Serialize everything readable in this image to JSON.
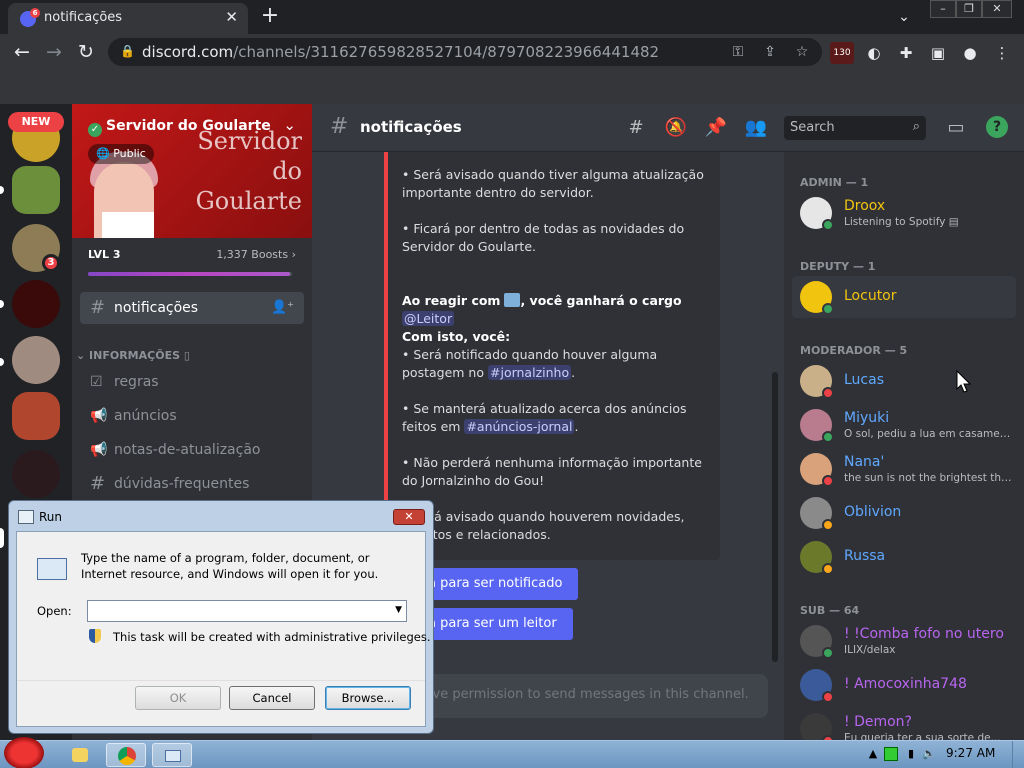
{
  "browser": {
    "tab_title": "notificações",
    "tab_badge": "6",
    "url_domain": "discord.com",
    "url_path": "/channels/311627659828527104/879708223966441482",
    "ext_badge": "130"
  },
  "guilds": {
    "new_badge": "NEW",
    "mention_count": "3"
  },
  "server": {
    "name": "Servidor do Goularte",
    "public_label": "Public",
    "banner_art_lines": [
      "Servidor",
      "do",
      "Goularte"
    ],
    "level": "LVL 3",
    "boosts": "1,337 Boosts",
    "boost_progress": 0.99,
    "selected_channel": "notificações",
    "category": "INFORMAÇÕES",
    "channels": [
      "regras",
      "anúncios",
      "notas-de-atualização",
      "dúvidas-frequentes"
    ]
  },
  "header": {
    "channel": "notificações",
    "search_placeholder": "Search"
  },
  "embed": {
    "p1": "• Será avisado quando tiver alguma atualização importante dentro do servidor.",
    "p2": "• Ficará por dentro de todas as novidades do Servidor do Goularte.",
    "react_prefix": "Ao reagir com",
    "react_mid": ", você ganhará o cargo",
    "role": "@Leitor",
    "react_after": "Com isto, você:",
    "p3_a": "• Será notificado quando houver alguma postagem no",
    "channel_a": "#jornalzinho",
    "p4_a": "• Se manterá atualizado acerca dos anúncios feitos em",
    "channel_b": "#anúncios-jornal",
    "p5": "• Não perderá nenhuma informação importante do Jornalzinho do Gou!",
    "p6": "• Será avisado quando houverem novidades, eventos e relacionados."
  },
  "buttons": {
    "notify": "Reaja para ser notificado",
    "reader": "Reaja para ser um leitor"
  },
  "chat_input": {
    "placeholder": "You do not have permission to send messages in this channel."
  },
  "members": {
    "groups": [
      {
        "label": "ADMIN — 1"
      },
      {
        "label": "DEPUTY — 1"
      },
      {
        "label": "MODERADOR — 5"
      },
      {
        "label": "SUB — 64"
      }
    ],
    "admin": [
      {
        "name": "Droox",
        "sub": "Listening to Spotify"
      }
    ],
    "deputy": [
      {
        "name": "Locutor"
      }
    ],
    "moderators": [
      {
        "name": "Lucas"
      },
      {
        "name": "Miyuki",
        "sub": "O sol, pediu a lua em casamento"
      },
      {
        "name": "Nana'",
        "sub": "the sun is not the brightest thing"
      },
      {
        "name": "Oblivion"
      },
      {
        "name": "Russa"
      }
    ],
    "subs": [
      {
        "name": "! !Comba fofo no utero",
        "sub": "ILIX/delax"
      },
      {
        "name": "! Amocoxinha748"
      },
      {
        "name": "! Demon?",
        "sub": "Eu queria ter a sua sorte de..."
      }
    ],
    "colors": {
      "admin": "#f1c40f",
      "deputy": "#f1c40f",
      "mod": "#5fa8ff",
      "sub": "#b865f0"
    }
  },
  "run_dialog": {
    "title": "Run",
    "description": "Type the name of a program, folder, document, or Internet resource, and Windows will open it for you.",
    "open_label": "Open:",
    "open_value": "",
    "privilege_note": "This task will be created with administrative privileges.",
    "ok": "OK",
    "cancel": "Cancel",
    "browse": "Browse..."
  },
  "taskbar": {
    "clock": "9:27 AM"
  }
}
